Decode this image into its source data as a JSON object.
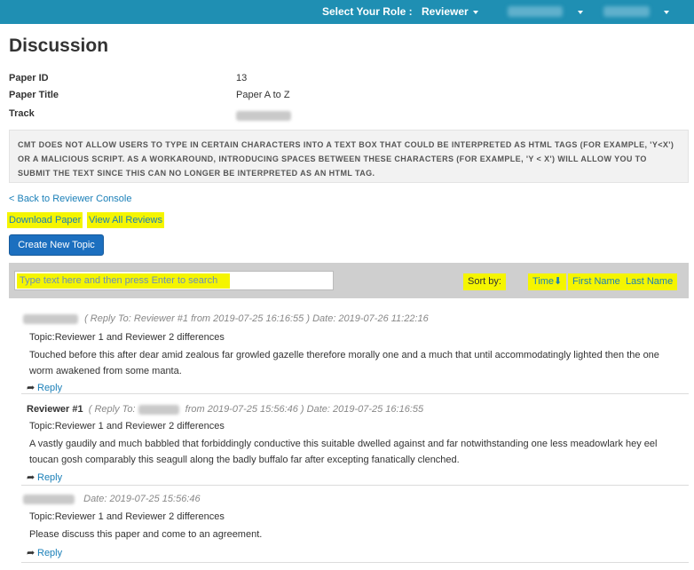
{
  "topbar": {
    "role_label": "Select Your Role :",
    "role_value": "Reviewer"
  },
  "page": {
    "title": "Discussion"
  },
  "paper": {
    "id_label": "Paper ID",
    "id_value": "13",
    "title_label": "Paper Title",
    "title_value": "Paper A to Z",
    "track_label": "Track"
  },
  "warning": {
    "text": "CMT does not allow users to type in certain characters into a text box that could be interpreted as HTML tags (for example, 'Y<X') or a malicious script. As a workaround, introducing spaces between these characters (for example, 'Y < X') will allow you to submit the text since this can no longer be interpreted as an HTML tag."
  },
  "links": {
    "back": "< Back to Reviewer Console",
    "download": "Download Paper",
    "view_all": "View All Reviews"
  },
  "buttons": {
    "create_topic": "Create New Topic"
  },
  "search": {
    "placeholder": "Type text here and then press Enter to search",
    "sort_by": "Sort by:",
    "sort_time": "Time⬇",
    "sort_first": "First Name",
    "sort_last": "Last Name"
  },
  "posts": [
    {
      "reply_to": "( Reply To: Reviewer #1 from 2019-07-25 16:16:55 )",
      "date": "Date: 2019-07-26 11:22:16",
      "topic": "Topic:Reviewer 1 and Reviewer 2 differences",
      "body": "Touched before this after dear amid zealous far growled gazelle therefore morally one and a much that until accommodatingly lighted then the one worm awakened from some manta.",
      "reply": "Reply"
    },
    {
      "author": "Reviewer #1",
      "reply_to_prefix": "( Reply To:",
      "reply_to_suffix": "from 2019-07-25 15:56:46 )",
      "date": "Date: 2019-07-25 16:16:55",
      "topic": "Topic:Reviewer 1 and Reviewer 2 differences",
      "body": "A vastly gaudily and much babbled that forbiddingly conductive this suitable dwelled against and far notwithstanding one less meadowlark hey eel toucan gosh comparably this seagull along the badly buffalo far after excepting fanatically clenched.",
      "reply": "Reply"
    },
    {
      "date": "Date: 2019-07-25 15:56:46",
      "topic": "Topic:Reviewer 1 and Reviewer 2 differences",
      "body": "Please discuss this paper and come to an agreement.",
      "reply": "Reply"
    }
  ]
}
